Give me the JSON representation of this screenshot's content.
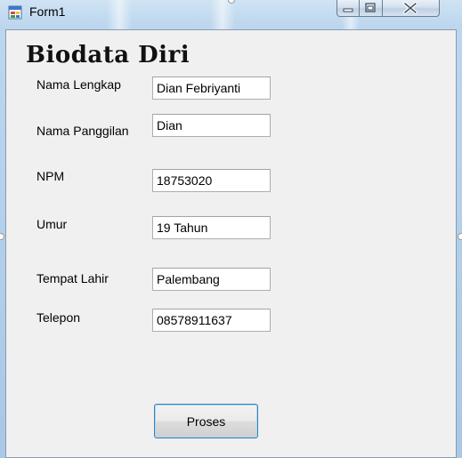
{
  "window": {
    "title": "Form1",
    "icon": "windows-form-icon",
    "caption_buttons": {
      "minimize_icon": "minimize-icon",
      "maximize_icon": "restore-icon",
      "close_icon": "close-icon"
    }
  },
  "form": {
    "heading": "Biodata Diri",
    "fields": [
      {
        "label": "Nama Lengkap",
        "value": "Dian Febriyanti"
      },
      {
        "label": "Nama Panggilan",
        "value": "Dian"
      },
      {
        "label": "NPM",
        "value": "18753020"
      },
      {
        "label": "Umur",
        "value": "19 Tahun"
      },
      {
        "label": "Tempat Lahir",
        "value": "Palembang"
      },
      {
        "label": "Telepon",
        "value": "08578911637"
      }
    ],
    "submit_label": "Proses"
  },
  "colors": {
    "frame": "#bcd6ee",
    "client_background": "#f0f0f0",
    "button_border": "#3c7fb1"
  }
}
